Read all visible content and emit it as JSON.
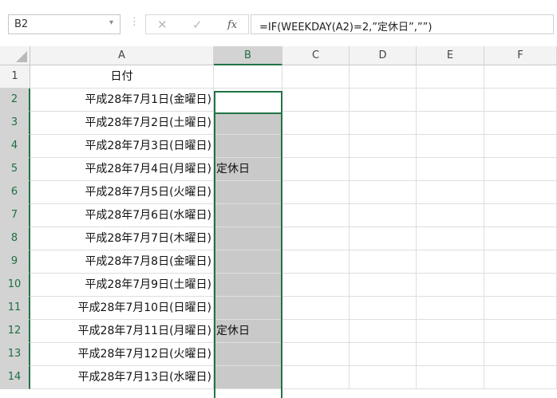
{
  "formula_bar": {
    "name_box": "B2",
    "name_box_arrow": "▾",
    "dots": "⋮",
    "cancel": "✕",
    "enter": "✓",
    "fx": "fx",
    "formula": "=IF(WEEKDAY(A2)=2,”定休日”,””)"
  },
  "columns": [
    "A",
    "B",
    "C",
    "D",
    "E",
    "F"
  ],
  "rows": [
    {
      "num": "1",
      "a": "日付",
      "b": ""
    },
    {
      "num": "2",
      "a": "平成28年7月1日(金曜日)",
      "b": ""
    },
    {
      "num": "3",
      "a": "平成28年7月2日(土曜日)",
      "b": ""
    },
    {
      "num": "4",
      "a": "平成28年7月3日(日曜日)",
      "b": ""
    },
    {
      "num": "5",
      "a": "平成28年7月4日(月曜日)",
      "b": "定休日"
    },
    {
      "num": "6",
      "a": "平成28年7月5日(火曜日)",
      "b": ""
    },
    {
      "num": "7",
      "a": "平成28年7月6日(水曜日)",
      "b": ""
    },
    {
      "num": "8",
      "a": "平成28年7月7日(木曜日)",
      "b": ""
    },
    {
      "num": "9",
      "a": "平成28年7月8日(金曜日)",
      "b": ""
    },
    {
      "num": "10",
      "a": "平成28年7月9日(土曜日)",
      "b": ""
    },
    {
      "num": "11",
      "a": "平成28年7月10日(日曜日)",
      "b": ""
    },
    {
      "num": "12",
      "a": "平成28年7月11日(月曜日)",
      "b": "定休日"
    },
    {
      "num": "13",
      "a": "平成28年7月12日(火曜日)",
      "b": ""
    },
    {
      "num": "14",
      "a": "平成28年7月13日(水曜日)",
      "b": ""
    }
  ],
  "colors": {
    "selection_green": "#217346",
    "selected_fill": "#c9c9c9"
  }
}
